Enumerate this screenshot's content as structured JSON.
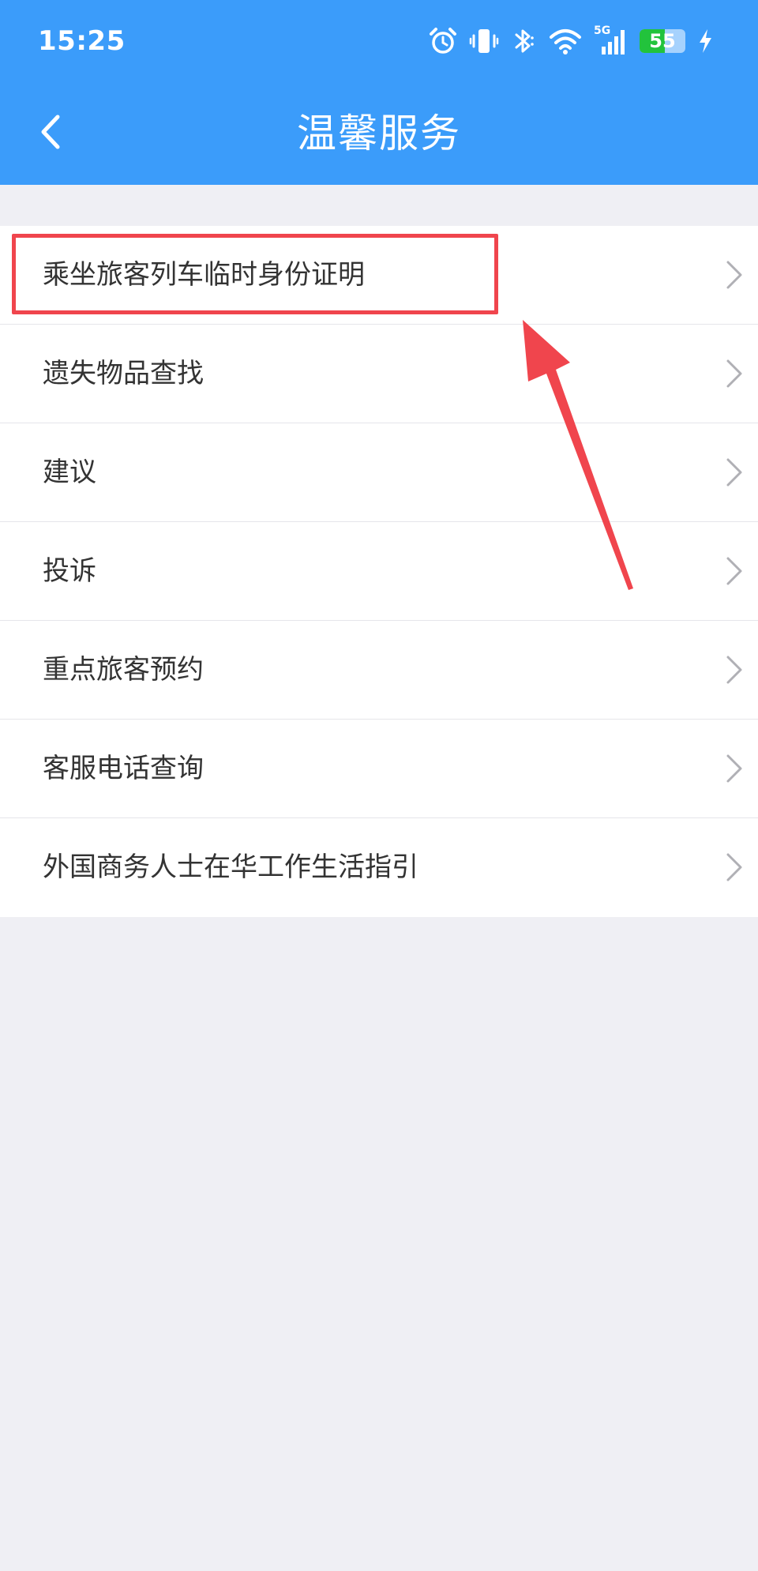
{
  "status_bar": {
    "time": "15:25",
    "network_label": "5G",
    "battery_level": "55",
    "battery_fraction": 0.55,
    "icons": [
      "alarm-icon",
      "vibrate-icon",
      "bluetooth-icon",
      "wifi-icon",
      "cellular-signal-icon",
      "battery-icon",
      "charging-icon"
    ]
  },
  "nav": {
    "title": "温馨服务",
    "back_icon": "chevron-left-icon"
  },
  "menu": {
    "items": [
      {
        "label": "乘坐旅客列车临时身份证明"
      },
      {
        "label": "遗失物品查找"
      },
      {
        "label": "建议"
      },
      {
        "label": "投诉"
      },
      {
        "label": "重点旅客预约"
      },
      {
        "label": "客服电话查询"
      },
      {
        "label": "外国商务人士在华工作生活指引"
      }
    ],
    "chevron_icon": "chevron-right-icon"
  },
  "colors": {
    "header_bg": "#3b9cfa",
    "page_bg": "#efeff4",
    "highlight": "#f0454d",
    "battery_green": "#22c33c"
  }
}
